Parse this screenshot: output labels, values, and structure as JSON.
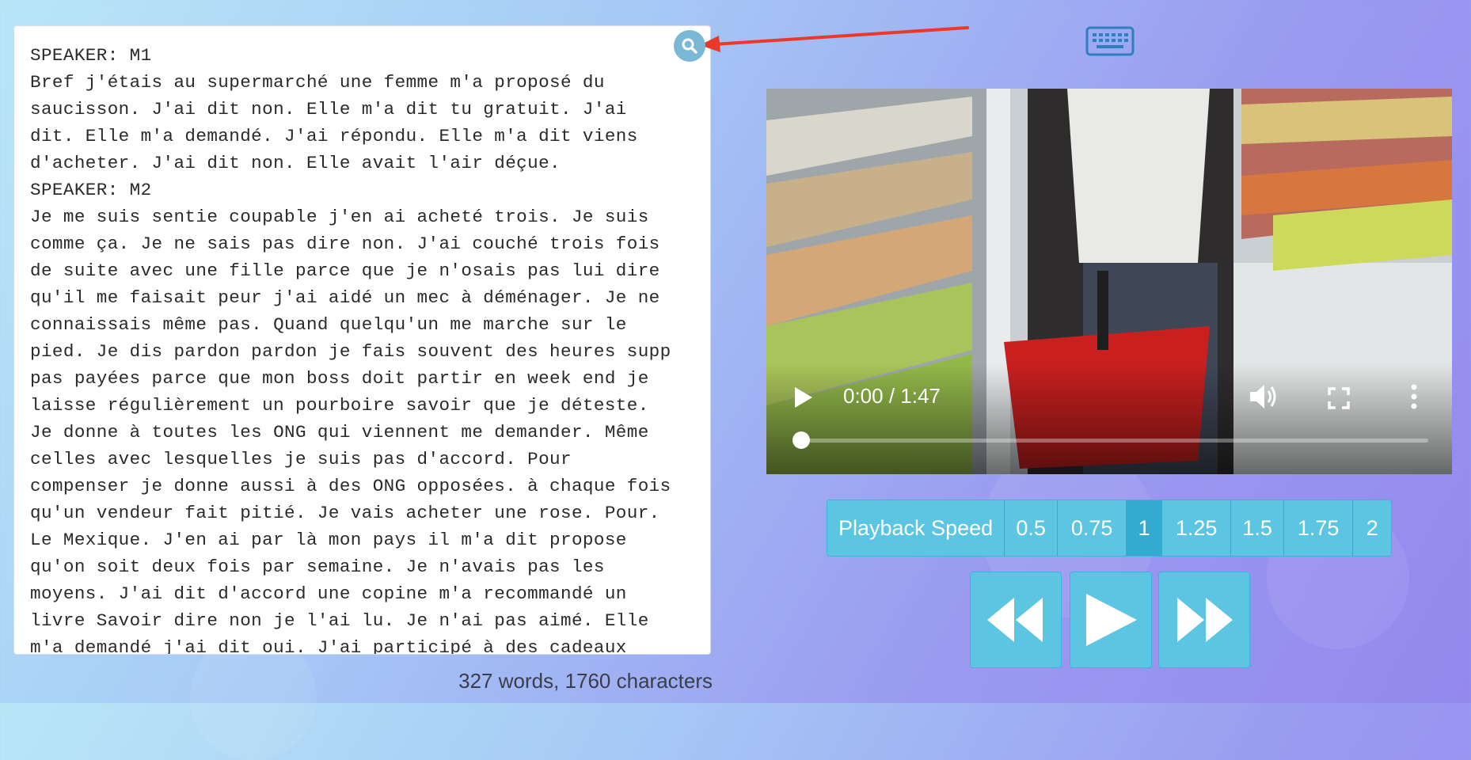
{
  "transcript": {
    "lines": [
      "SPEAKER: M1",
      "Bref j'étais au supermarché une femme m'a proposé du",
      "saucisson. J'ai dit non. Elle m'a dit tu gratuit. J'ai",
      "dit. Elle m'a demandé. J'ai répondu. Elle m'a dit viens",
      "d'acheter. J'ai dit non. Elle avait l'air déçue.",
      "SPEAKER: M2",
      "Je me suis sentie coupable j'en ai acheté trois. Je suis",
      "comme ça. Je ne sais pas dire non. J'ai couché trois fois",
      "de suite avec une fille parce que je n'osais pas lui dire",
      "qu'il me faisait peur j'ai aidé un mec à déménager. Je ne",
      "connaissais même pas. Quand quelqu'un me marche sur le",
      "pied. Je dis pardon pardon je fais souvent des heures supp",
      "pas payées parce que mon boss doit partir en week end je",
      "laisse régulièrement un pourboire savoir que je déteste.",
      "Je donne à toutes les ONG qui viennent me demander. Même",
      "celles avec lesquelles je suis pas d'accord. Pour",
      "compenser je donne aussi à des ONG opposées. à chaque fois",
      "qu'un vendeur fait pitié. Je vais acheter une rose. Pour.",
      "Le Mexique. J'en ai par là mon pays il m'a dit propose",
      "qu'on soit deux fois par semaine. Je n'avais pas les",
      "moyens. J'ai dit d'accord une copine m'a recommandé un",
      "livre Savoir dire non je l'ai lu. Je n'ai pas aimé. Elle",
      "m'a demandé j'ai dit oui. J'ai participé à des cadeaux"
    ],
    "counts": "327 words, 1760 characters"
  },
  "icons": {
    "search": "search-icon",
    "keyboard": "keyboard-icon",
    "play": "play-icon",
    "volume": "volume-icon",
    "fullscreen": "fullscreen-icon",
    "more": "more-vertical-icon",
    "rewind": "rewind-icon",
    "fast_forward": "fast-forward-icon"
  },
  "video": {
    "time": "0:00 / 1:47",
    "progress_fraction": 0.0
  },
  "speed": {
    "label": "Playback Speed",
    "options": [
      "0.5",
      "0.75",
      "1",
      "1.25",
      "1.5",
      "1.75",
      "2"
    ],
    "selected": "1"
  },
  "colors": {
    "accent": "#5bc5e2",
    "accent_active": "#33abd0",
    "annotation_arrow": "#e8392b",
    "search_button": "#7ab8d6"
  }
}
